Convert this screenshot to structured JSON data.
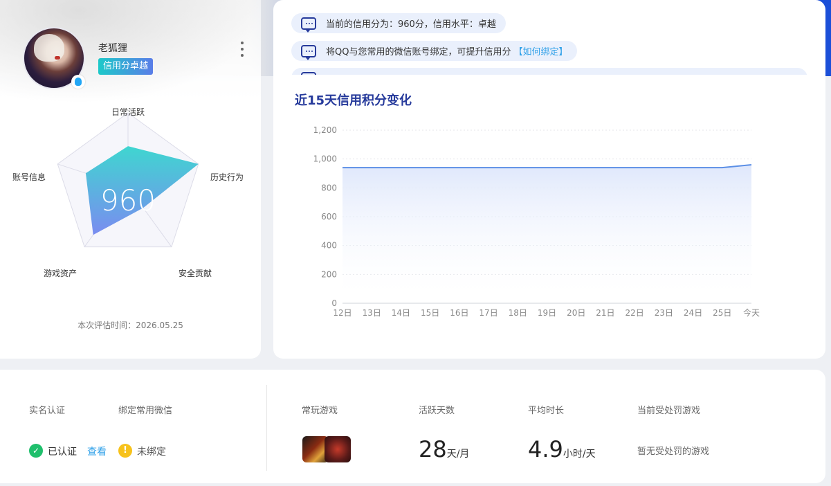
{
  "profile": {
    "username": "老狐狸",
    "credit_badge": "信用分卓越",
    "score": "960",
    "eval_time": "本次评估时间：2026.05.25",
    "radar_labels": [
      "日常活跃",
      "历史行为",
      "安全贡献",
      "游戏资产",
      "账号信息"
    ],
    "radar_values": [
      0.55,
      1.0,
      0.35,
      0.8,
      0.6
    ],
    "radar_color_top": "#3fd6d0",
    "radar_color_bottom": "#7a8cf0"
  },
  "notices": [
    {
      "text": "当前的信用分为：960分，信用水平：卓越",
      "link": ""
    },
    {
      "text": "将QQ与您常用的微信账号绑定，可提升信用分",
      "link": "【如何绑定】"
    },
    {
      "text": "",
      "link": ""
    }
  ],
  "chart_title": "近15天信用积分变化",
  "chart_data": {
    "type": "area",
    "title": "近15天信用积分变化",
    "categories": [
      "12日",
      "13日",
      "14日",
      "15日",
      "16日",
      "17日",
      "18日",
      "19日",
      "20日",
      "21日",
      "22日",
      "23日",
      "24日",
      "25日",
      "今天"
    ],
    "x_tick_labels": [
      "12日",
      "13日",
      "14日",
      "15日",
      "16日",
      "17日",
      "18日",
      "19日",
      "20日",
      "21日",
      "22日",
      "23日",
      "24日",
      "25日",
      "今天"
    ],
    "values": [
      940,
      940,
      940,
      940,
      940,
      940,
      940,
      940,
      940,
      940,
      940,
      940,
      940,
      940,
      960
    ],
    "ylim": [
      0,
      1200
    ],
    "y_ticks": [
      "0",
      "200",
      "400",
      "600",
      "800",
      "1,000",
      "1,200"
    ],
    "grid": "horizontal dotted",
    "line_color": "#5b8fe6",
    "fill_color": "#dde6fb"
  },
  "stats": {
    "realname": {
      "label": "实名认证",
      "value": "已认证",
      "link": "查看"
    },
    "wechat": {
      "label": "绑定常用微信",
      "value": "未绑定"
    },
    "games": {
      "label": "常玩游戏"
    },
    "active_days": {
      "label": "活跃天数",
      "value": "28",
      "unit": "天/月"
    },
    "avg_time": {
      "label": "平均时长",
      "value": "4.9",
      "unit": "小时/天"
    },
    "punish": {
      "label": "当前受处罚游戏",
      "value": "暂无受处罚的游戏"
    }
  }
}
